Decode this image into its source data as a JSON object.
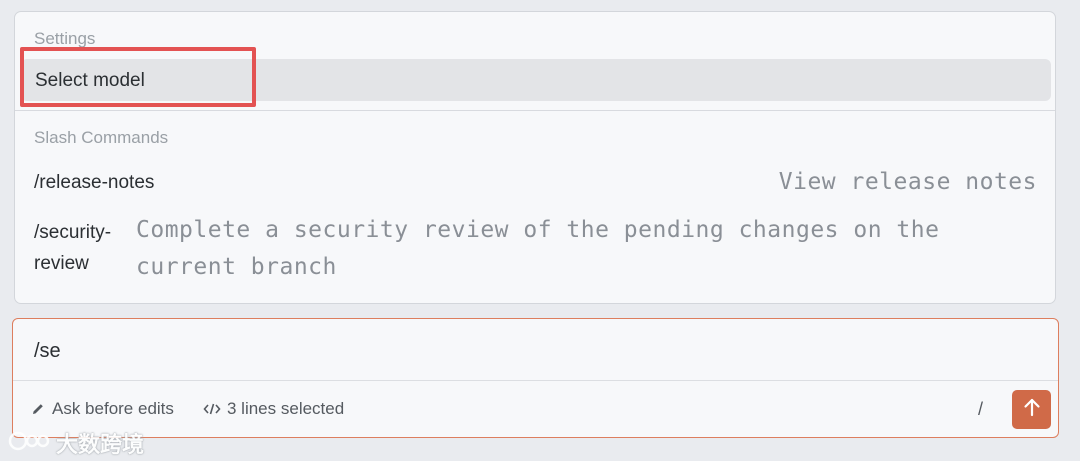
{
  "menu": {
    "settings_title": "Settings",
    "select_model_label": "Select model",
    "slash_commands_title": "Slash Commands",
    "commands": [
      {
        "name": "/release-notes",
        "description": "View release notes"
      },
      {
        "name": "/security-review",
        "name_line1": "/security-",
        "name_line2": "review",
        "description": "Complete a security review of the pending changes on the current branch"
      }
    ],
    "highlight_color": "#e35252"
  },
  "composer": {
    "input_value": "/se",
    "mode_label": "Ask before edits",
    "selection_label": "3 lines selected",
    "slash_hint": "/",
    "accent_color": "#d06a48",
    "icons": {
      "mode": "pencil-icon",
      "selection": "code-icon",
      "send": "arrow-up-icon"
    }
  },
  "watermark": {
    "text": "大数跨境"
  }
}
